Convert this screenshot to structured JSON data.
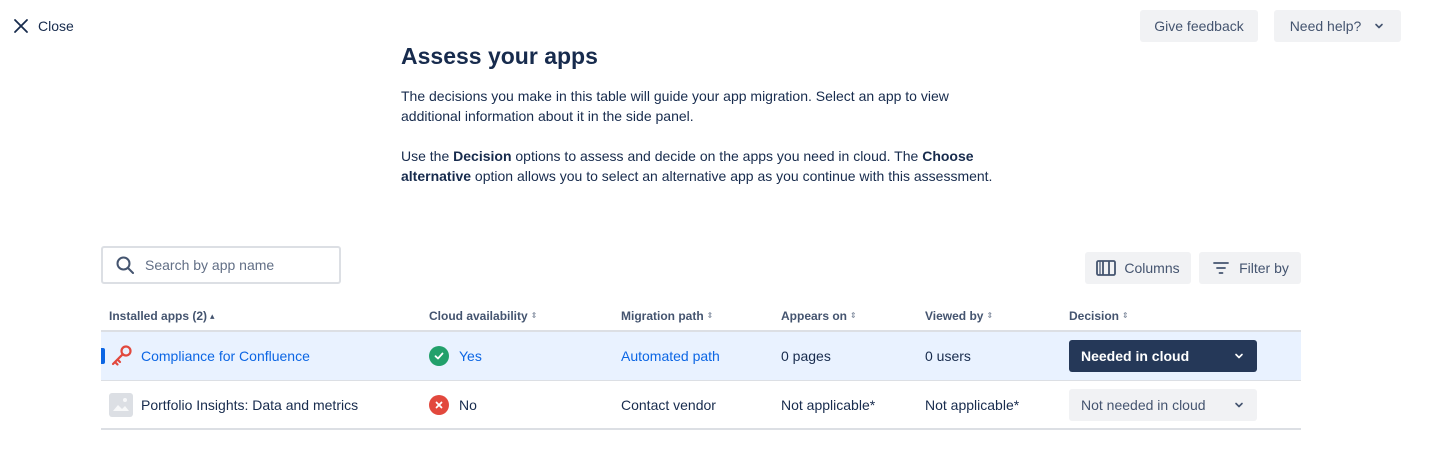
{
  "topbar": {
    "close_label": "Close",
    "feedback_label": "Give feedback",
    "help_label": "Need help?"
  },
  "header": {
    "title": "Assess your apps",
    "intro_p1": "The decisions you make in this table will guide your app migration. Select an app to view additional information about it in the side panel.",
    "intro_p2_pre": "Use the ",
    "intro_p2_b1": "Decision",
    "intro_p2_mid": " options to assess and decide on the apps you need in cloud. The ",
    "intro_p2_b2": "Choose alternative",
    "intro_p2_post": " option allows you to select an alternative app as you continue with this assessment."
  },
  "search": {
    "placeholder": "Search by app name",
    "value": ""
  },
  "toolbar": {
    "columns_label": "Columns",
    "filter_label": "Filter by"
  },
  "table": {
    "headers": {
      "installed": "Installed apps (2)",
      "cloud": "Cloud availability",
      "migration": "Migration path",
      "appears": "Appears on",
      "viewed": "Viewed by",
      "decision": "Decision"
    },
    "rows": [
      {
        "name": "Compliance for Confluence",
        "cloud": "Yes",
        "migration": "Automated path",
        "appears": "0 pages",
        "viewed": "0 users",
        "decision": "Needed in cloud"
      },
      {
        "name": "Portfolio Insights: Data and metrics",
        "cloud": "No",
        "migration": "Contact vendor",
        "appears": "Not applicable*",
        "viewed": "Not applicable*",
        "decision": "Not needed in cloud"
      }
    ]
  },
  "colors": {
    "link": "#0c66e4",
    "selected_row": "#e9f2ff",
    "yes": "#22a06b",
    "no": "#e2483d",
    "decision_dark": "#253858"
  }
}
